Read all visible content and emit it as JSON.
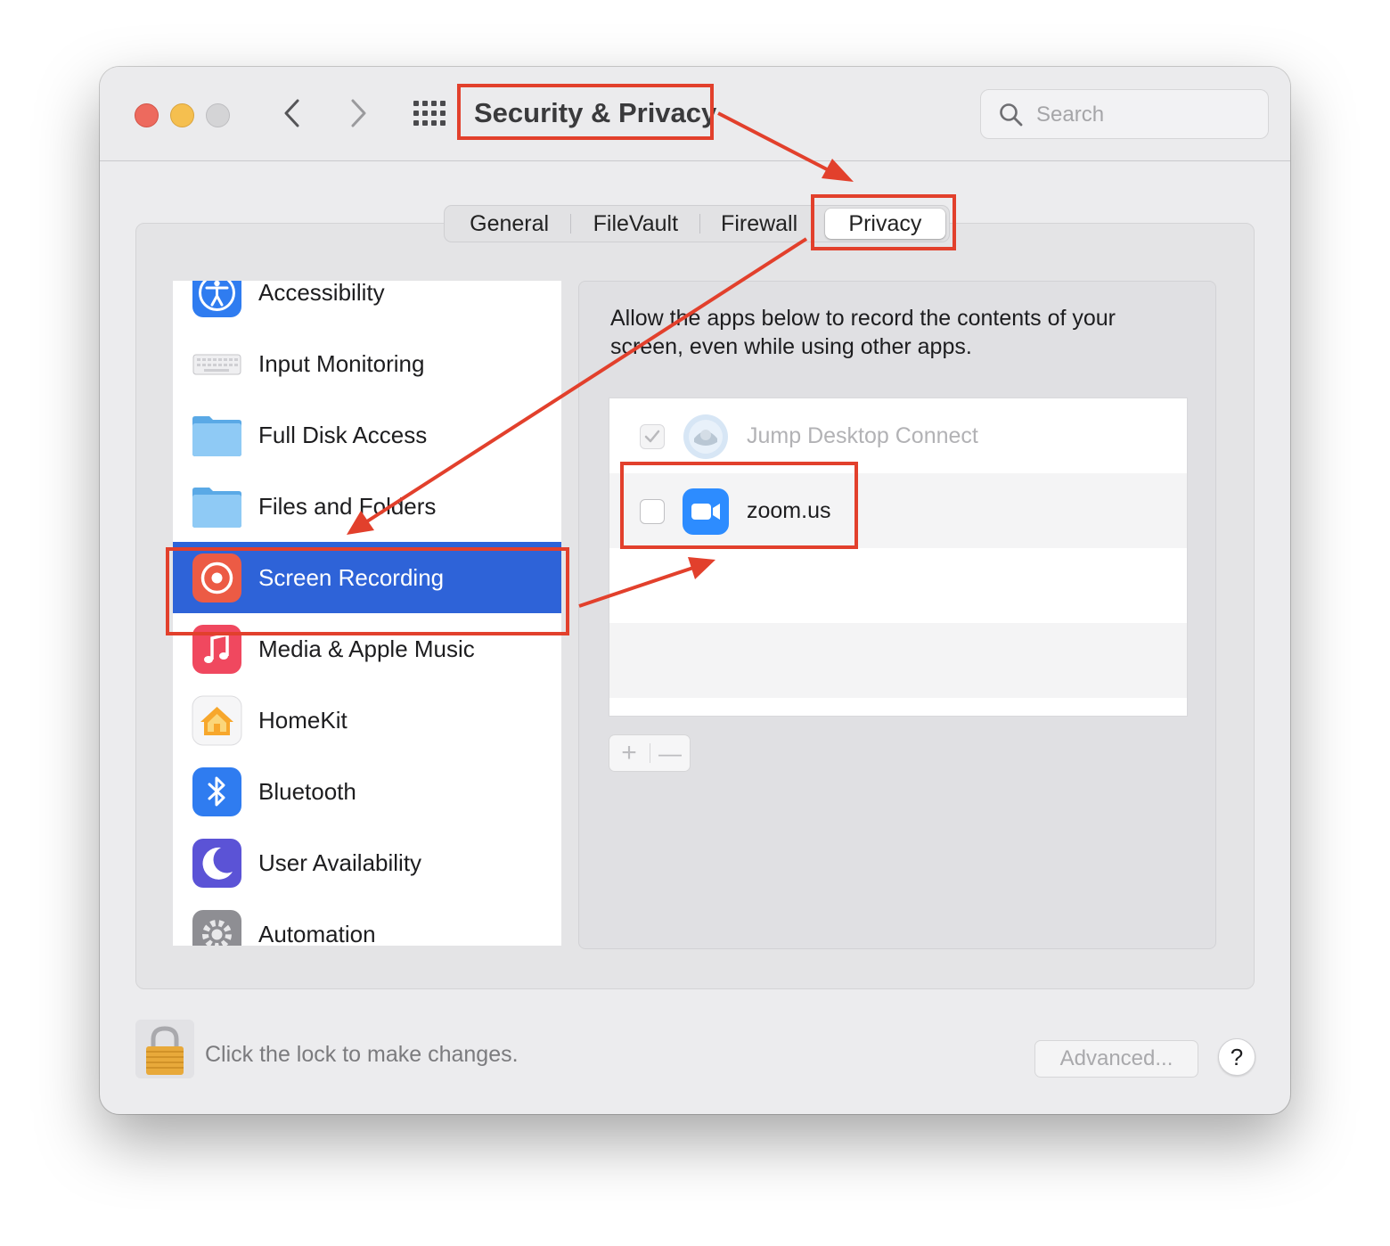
{
  "window": {
    "title": "Security & Privacy",
    "search_placeholder": "Search"
  },
  "tabs": [
    {
      "label": "General",
      "selected": false
    },
    {
      "label": "FileVault",
      "selected": false
    },
    {
      "label": "Firewall",
      "selected": false
    },
    {
      "label": "Privacy",
      "selected": true
    }
  ],
  "sidebar": {
    "items": [
      {
        "label": "Accessibility",
        "icon": "accessibility-icon"
      },
      {
        "label": "Input Monitoring",
        "icon": "keyboard-icon"
      },
      {
        "label": "Full Disk Access",
        "icon": "folder-icon"
      },
      {
        "label": "Files and Folders",
        "icon": "folder-icon"
      },
      {
        "label": "Screen Recording",
        "icon": "screen-recording-icon",
        "selected": true
      },
      {
        "label": "Media & Apple Music",
        "icon": "music-icon"
      },
      {
        "label": "HomeKit",
        "icon": "home-icon"
      },
      {
        "label": "Bluetooth",
        "icon": "bluetooth-icon"
      },
      {
        "label": "User Availability",
        "icon": "moon-icon"
      },
      {
        "label": "Automation",
        "icon": "gear-icon"
      }
    ]
  },
  "detail": {
    "description": "Allow the apps below to record the contents of your screen, even while using other apps.",
    "apps": [
      {
        "name": "Jump Desktop Connect",
        "checked": true,
        "disabled": true,
        "icon": "jump-desktop-icon"
      },
      {
        "name": "zoom.us",
        "checked": false,
        "disabled": false,
        "icon": "zoom-icon"
      }
    ],
    "add_label": "+",
    "remove_label": "—"
  },
  "footer": {
    "lock_text": "Click the lock to make changes.",
    "advanced_label": "Advanced...",
    "help_label": "?"
  },
  "colors": {
    "selection": "#2e63d8",
    "annotation": "#e2402c"
  }
}
